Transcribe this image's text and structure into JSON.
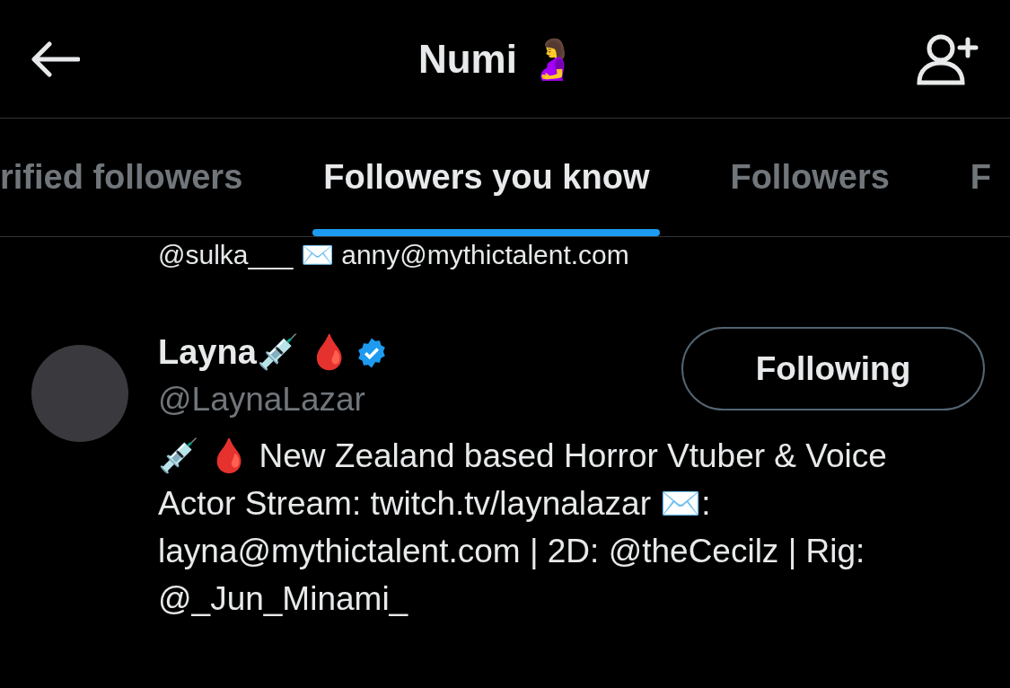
{
  "header": {
    "title": "Numi 🤰"
  },
  "tabs": [
    {
      "label": "rified followers",
      "selected": false
    },
    {
      "label": "Followers you know",
      "selected": true
    },
    {
      "label": "Followers",
      "selected": false
    },
    {
      "label": "F",
      "selected": false
    }
  ],
  "clipped_line": "@sulka___ ✉️ anny@mythictalent.com",
  "accounts": [
    {
      "name": "Layna💉 🩸",
      "verified": true,
      "handle": "@LaynaLazar",
      "button": "Following",
      "following": true,
      "bio": "💉 🩸 New Zealand based Horror Vtuber & Voice Actor Stream: twitch.tv/laynalazar ✉️: layna@mythictalent.com | 2D: @theCecilz | Rig: @_Jun_Minami_"
    }
  ]
}
